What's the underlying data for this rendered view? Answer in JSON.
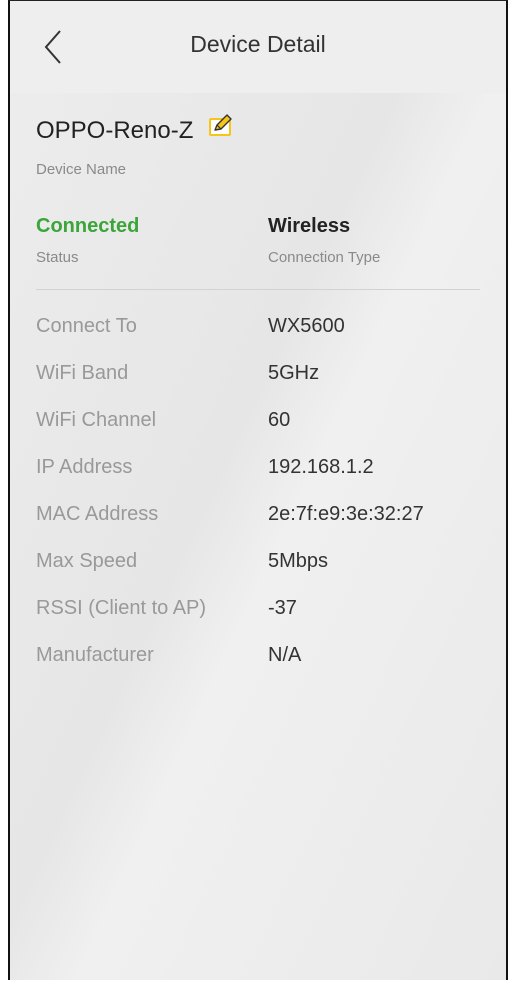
{
  "header": {
    "title": "Device Detail",
    "back_icon": "chevron-left-icon"
  },
  "device": {
    "name": "OPPO-Reno-Z",
    "name_caption": "Device Name",
    "edit_icon": "edit-icon",
    "edit_icon_color": "#f5c518"
  },
  "status": {
    "value": "Connected",
    "caption": "Status",
    "color": "#3aa63a"
  },
  "connection": {
    "value": "Wireless",
    "caption": "Connection Type"
  },
  "details": [
    {
      "label": "Connect To",
      "value": "WX5600"
    },
    {
      "label": "WiFi Band",
      "value": "5GHz"
    },
    {
      "label": "WiFi Channel",
      "value": "60"
    },
    {
      "label": "IP Address",
      "value": "192.168.1.2"
    },
    {
      "label": "MAC Address",
      "value": "2e:7f:e9:3e:32:27"
    },
    {
      "label": "Max Speed",
      "value": "5Mbps"
    },
    {
      "label": "RSSI (Client to AP)",
      "value": "-37"
    },
    {
      "label": "Manufacturer",
      "value": "N/A"
    }
  ]
}
